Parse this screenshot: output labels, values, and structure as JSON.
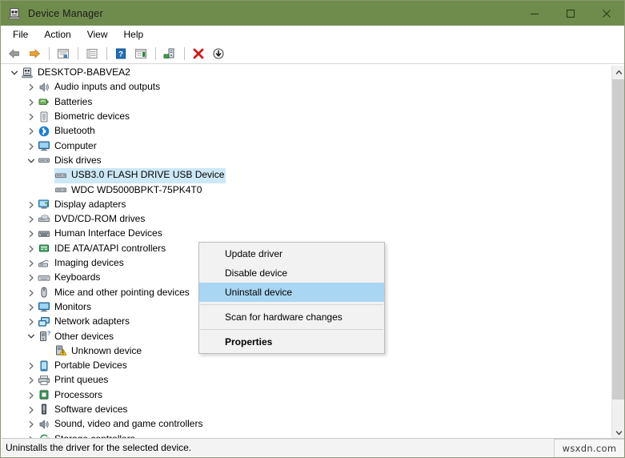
{
  "window": {
    "title": "Device Manager",
    "icon": "device-manager-icon",
    "title_bar_color": "#708c4d",
    "controls": {
      "minimize": "minimize-button",
      "maximize": "maximize-button",
      "close": "close-button"
    }
  },
  "menubar": {
    "items": [
      {
        "label": "File"
      },
      {
        "label": "Action"
      },
      {
        "label": "View"
      },
      {
        "label": "Help"
      }
    ]
  },
  "toolbar": {
    "buttons": [
      {
        "name": "back-icon"
      },
      {
        "name": "forward-icon"
      },
      {
        "name": "separator"
      },
      {
        "name": "show-hide-console-tree-icon"
      },
      {
        "name": "separator"
      },
      {
        "name": "properties-icon"
      },
      {
        "name": "separator"
      },
      {
        "name": "help-icon"
      },
      {
        "name": "show-hide-action-pane-icon"
      },
      {
        "name": "separator"
      },
      {
        "name": "scan-for-hardware-changes-icon"
      },
      {
        "name": "separator"
      },
      {
        "name": "update-driver-software-icon"
      },
      {
        "name": "uninstall-device-icon"
      },
      {
        "name": "disable-device-icon"
      }
    ]
  },
  "tree": {
    "items": [
      {
        "label": "DESKTOP-BABVEA2",
        "depth": 0,
        "twisty": "expanded",
        "icon": "computer-icon",
        "selected": false
      },
      {
        "label": "Audio inputs and outputs",
        "depth": 1,
        "twisty": "collapsed",
        "icon": "audio-icon",
        "selected": false
      },
      {
        "label": "Batteries",
        "depth": 1,
        "twisty": "collapsed",
        "icon": "battery-icon",
        "selected": false
      },
      {
        "label": "Biometric devices",
        "depth": 1,
        "twisty": "collapsed",
        "icon": "biometric-icon",
        "selected": false
      },
      {
        "label": "Bluetooth",
        "depth": 1,
        "twisty": "collapsed",
        "icon": "bluetooth-icon",
        "selected": false
      },
      {
        "label": "Computer",
        "depth": 1,
        "twisty": "collapsed",
        "icon": "monitor-icon",
        "selected": false
      },
      {
        "label": "Disk drives",
        "depth": 1,
        "twisty": "expanded",
        "icon": "disk-drive-icon",
        "selected": false
      },
      {
        "label": "USB3.0 FLASH DRIVE USB Device",
        "depth": 2,
        "twisty": "none",
        "icon": "disk-drive-icon",
        "selected": true
      },
      {
        "label": "WDC WD5000BPKT-75PK4T0",
        "depth": 2,
        "twisty": "none",
        "icon": "disk-drive-icon",
        "selected": false
      },
      {
        "label": "Display adapters",
        "depth": 1,
        "twisty": "collapsed",
        "icon": "display-adapter-icon",
        "selected": false
      },
      {
        "label": "DVD/CD-ROM drives",
        "depth": 1,
        "twisty": "collapsed",
        "icon": "dvd-drive-icon",
        "selected": false
      },
      {
        "label": "Human Interface Devices",
        "depth": 1,
        "twisty": "collapsed",
        "icon": "hid-icon",
        "selected": false
      },
      {
        "label": "IDE ATA/ATAPI controllers",
        "depth": 1,
        "twisty": "collapsed",
        "icon": "ide-controller-icon",
        "selected": false
      },
      {
        "label": "Imaging devices",
        "depth": 1,
        "twisty": "collapsed",
        "icon": "imaging-icon",
        "selected": false
      },
      {
        "label": "Keyboards",
        "depth": 1,
        "twisty": "collapsed",
        "icon": "keyboard-icon",
        "selected": false
      },
      {
        "label": "Mice and other pointing devices",
        "depth": 1,
        "twisty": "collapsed",
        "icon": "mouse-icon",
        "selected": false
      },
      {
        "label": "Monitors",
        "depth": 1,
        "twisty": "collapsed",
        "icon": "monitor-icon",
        "selected": false
      },
      {
        "label": "Network adapters",
        "depth": 1,
        "twisty": "collapsed",
        "icon": "network-adapter-icon",
        "selected": false
      },
      {
        "label": "Other devices",
        "depth": 1,
        "twisty": "expanded",
        "icon": "other-devices-icon",
        "selected": false
      },
      {
        "label": "Unknown device",
        "depth": 2,
        "twisty": "none",
        "icon": "unknown-device-warning-icon",
        "selected": false
      },
      {
        "label": "Portable Devices",
        "depth": 1,
        "twisty": "collapsed",
        "icon": "portable-device-icon",
        "selected": false
      },
      {
        "label": "Print queues",
        "depth": 1,
        "twisty": "collapsed",
        "icon": "printer-icon",
        "selected": false
      },
      {
        "label": "Processors",
        "depth": 1,
        "twisty": "collapsed",
        "icon": "processor-icon",
        "selected": false
      },
      {
        "label": "Software devices",
        "depth": 1,
        "twisty": "collapsed",
        "icon": "software-device-icon",
        "selected": false
      },
      {
        "label": "Sound, video and game controllers",
        "depth": 1,
        "twisty": "collapsed",
        "icon": "sound-icon",
        "selected": false
      },
      {
        "label": "Storage controllers",
        "depth": 1,
        "twisty": "collapsed",
        "icon": "storage-controller-icon",
        "selected": false
      }
    ]
  },
  "context_menu": {
    "highlight_color": "#a9d6f2",
    "items": [
      {
        "label": "Update driver",
        "highlighted": false,
        "bold": false,
        "separator_after": false
      },
      {
        "label": "Disable device",
        "highlighted": false,
        "bold": false,
        "separator_after": false
      },
      {
        "label": "Uninstall device",
        "highlighted": true,
        "bold": false,
        "separator_after": true
      },
      {
        "label": "Scan for hardware changes",
        "highlighted": false,
        "bold": false,
        "separator_after": true
      },
      {
        "label": "Properties",
        "highlighted": false,
        "bold": true,
        "separator_after": false
      }
    ]
  },
  "statusbar": {
    "message": "Uninstalls the driver for the selected device."
  },
  "watermark": {
    "text": "wsxdn.com"
  }
}
